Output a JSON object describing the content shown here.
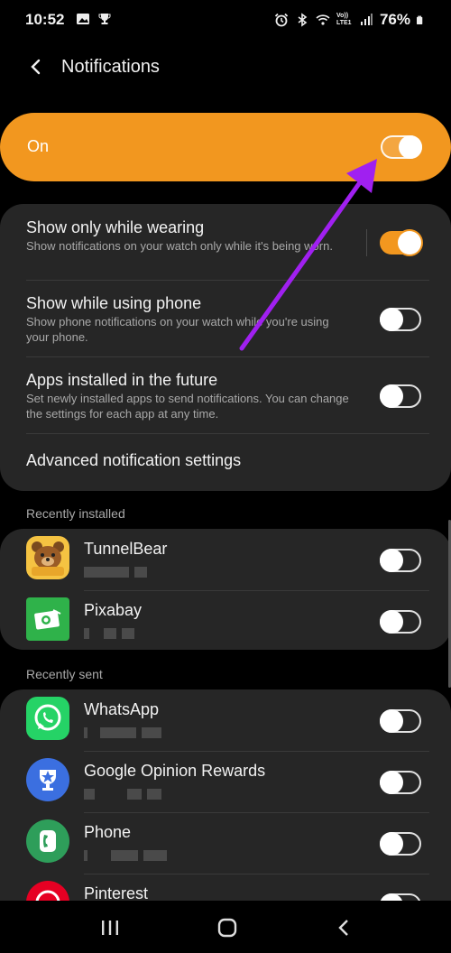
{
  "status_bar": {
    "time": "10:52",
    "battery": "76%",
    "left_icons": [
      "gallery-icon",
      "trophy-icon"
    ],
    "right_icons": [
      "alarm-icon",
      "bluetooth-icon",
      "wifi-icon",
      "volte-icon",
      "signal-icon",
      "battery-icon"
    ],
    "network_label": "Vo)) LTE1"
  },
  "header": {
    "title": "Notifications",
    "back_icon": "chevron-left-icon"
  },
  "master_switch": {
    "label": "On",
    "state": "on"
  },
  "settings": [
    {
      "title": "Show only while wearing",
      "description": "Show notifications on your watch only while it's being worn.",
      "state": "on"
    },
    {
      "title": "Show while using phone",
      "description": "Show phone notifications on your watch while you're using your phone.",
      "state": "off"
    },
    {
      "title": "Apps installed in the future",
      "description": "Set newly installed apps to send notifications. You can change the settings for each app at any time.",
      "state": "off"
    },
    {
      "title": "Advanced notification settings"
    }
  ],
  "recently_installed": {
    "label": "Recently installed",
    "apps": [
      {
        "name": "TunnelBear",
        "icon": "tunnelbear-icon",
        "state": "off"
      },
      {
        "name": "Pixabay",
        "icon": "pixabay-icon",
        "state": "off"
      }
    ]
  },
  "recently_sent": {
    "label": "Recently sent",
    "apps": [
      {
        "name": "WhatsApp",
        "icon": "whatsapp-icon",
        "state": "off"
      },
      {
        "name": "Google Opinion Rewards",
        "icon": "opinion-rewards-icon",
        "state": "off"
      },
      {
        "name": "Phone",
        "icon": "phone-icon",
        "state": "off"
      },
      {
        "name": "Pinterest",
        "icon": "pinterest-icon",
        "state": "off"
      }
    ]
  },
  "nav_bar": {
    "buttons": [
      "recents-icon",
      "home-icon",
      "back-icon"
    ]
  },
  "colors": {
    "accent": "#f2971f",
    "card": "#262626",
    "background": "#000000",
    "annotation_arrow": "#a020f0"
  }
}
